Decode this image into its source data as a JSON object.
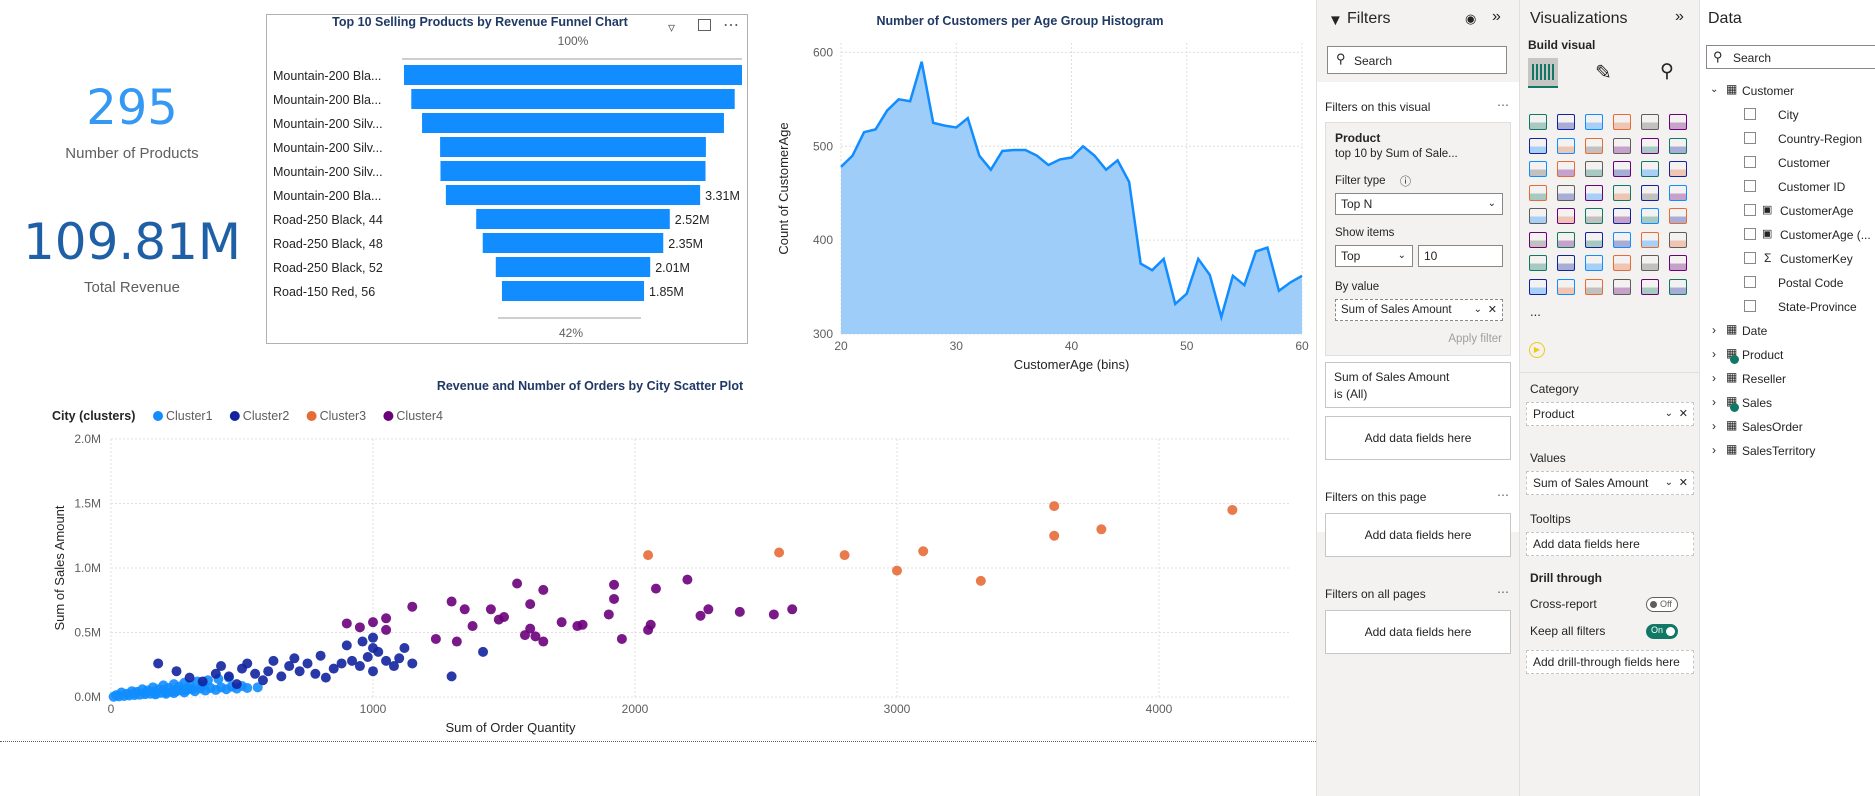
{
  "kpis": [
    {
      "value": "295",
      "label": "Number of Products"
    },
    {
      "value": "109.81M",
      "label": "Total Revenue"
    }
  ],
  "funnel": {
    "title": "Top 10 Selling Products by Revenue Funnel Chart",
    "top_pct": "100%",
    "bottom_pct": "42%",
    "data_labels": [
      "",
      "",
      "",
      "",
      "",
      "3.31M",
      "2.52M",
      "2.35M",
      "2.01M",
      "1.85M"
    ]
  },
  "histogram": {
    "title": "Number of Customers per Age Group Histogram",
    "xlabel": "CustomerAge (bins)",
    "ylabel": "Count of CustomerAge",
    "xticks": [
      "20",
      "30",
      "40",
      "50",
      "60"
    ],
    "yticks": [
      "300",
      "400",
      "500",
      "600"
    ]
  },
  "scatter": {
    "title": "Revenue and Number of Orders by City Scatter Plot",
    "legend_title": "City (clusters)",
    "xlabel": "Sum of Order Quantity",
    "ylabel": "Sum of Sales Amount",
    "xticks": [
      "0",
      "1000",
      "2000",
      "3000",
      "4000"
    ],
    "yticks": [
      "0.0M",
      "0.5M",
      "1.0M",
      "1.5M",
      "2.0M"
    ]
  },
  "chart_data": [
    {
      "type": "bar",
      "title": "Top 10 Selling Products by Revenue Funnel Chart",
      "categories": [
        "Mountain-200 Bla...",
        "Mountain-200 Bla...",
        "Mountain-200 Silv...",
        "Mountain-200 Silv...",
        "Mountain-200 Silv...",
        "Mountain-200 Bla...",
        "Road-250 Black, 44",
        "Road-250 Black, 48",
        "Road-250 Black, 52",
        "Road-150 Red, 56"
      ],
      "values": [
        4.4,
        4.21,
        3.93,
        3.46,
        3.45,
        3.31,
        2.52,
        2.35,
        2.01,
        1.85
      ],
      "unit": "M"
    },
    {
      "type": "area",
      "title": "Number of Customers per Age Group Histogram",
      "xlabel": "CustomerAge (bins)",
      "ylabel": "Count of CustomerAge",
      "xlim": [
        20,
        60
      ],
      "ylim": [
        300,
        610
      ],
      "x": [
        20,
        21,
        22,
        23,
        24,
        25,
        26,
        27,
        28,
        29,
        30,
        31,
        32,
        33,
        34,
        35,
        36,
        37,
        38,
        39,
        40,
        41,
        42,
        43,
        44,
        45,
        46,
        47,
        48,
        49,
        50,
        51,
        52,
        53,
        54,
        55,
        56,
        57,
        58,
        59,
        60
      ],
      "values": [
        478,
        490,
        515,
        518,
        538,
        550,
        548,
        590,
        525,
        522,
        520,
        530,
        490,
        475,
        495,
        496,
        496,
        490,
        480,
        486,
        488,
        500,
        490,
        475,
        485,
        462,
        375,
        368,
        380,
        332,
        343,
        380,
        363,
        318,
        362,
        352,
        388,
        392,
        346,
        355,
        362
      ]
    },
    {
      "type": "scatter",
      "title": "Revenue and Number of Orders by City Scatter Plot",
      "xlabel": "Sum of Order Quantity",
      "ylabel": "Sum of Sales Amount",
      "xlim": [
        0,
        4500
      ],
      "ylim": [
        0,
        2000000
      ],
      "legend_title": "City (clusters)",
      "series": [
        {
          "name": "Cluster1",
          "color": "#118dff",
          "points": [
            [
              10,
              2000
            ],
            [
              30,
              5000
            ],
            [
              50,
              8000
            ],
            [
              70,
              12000
            ],
            [
              90,
              15000
            ],
            [
              110,
              18000
            ],
            [
              130,
              22000
            ],
            [
              150,
              25000
            ],
            [
              170,
              28000
            ],
            [
              190,
              32000
            ],
            [
              210,
              35000
            ],
            [
              230,
              40000
            ],
            [
              250,
              45000
            ],
            [
              270,
              50000
            ],
            [
              290,
              55000
            ],
            [
              310,
              60000
            ],
            [
              340,
              65000
            ],
            [
              380,
              70000
            ],
            [
              420,
              75000
            ],
            [
              460,
              80000
            ],
            [
              500,
              85000
            ],
            [
              20,
              15000
            ],
            [
              60,
              25000
            ],
            [
              100,
              40000
            ],
            [
              140,
              50000
            ],
            [
              180,
              60000
            ],
            [
              220,
              70000
            ],
            [
              260,
              80000
            ],
            [
              300,
              90000
            ],
            [
              40,
              35000
            ],
            [
              80,
              45000
            ],
            [
              120,
              60000
            ],
            [
              160,
              75000
            ],
            [
              200,
              90000
            ],
            [
              240,
              100000
            ],
            [
              280,
              110000
            ],
            [
              330,
              120000
            ],
            [
              370,
              130000
            ],
            [
              410,
              140000
            ],
            [
              450,
              150000
            ],
            [
              160,
              40000
            ],
            [
              200,
              55000
            ],
            [
              240,
              30000
            ],
            [
              280,
              35000
            ],
            [
              320,
              45000
            ],
            [
              360,
              50000
            ],
            [
              400,
              55000
            ],
            [
              440,
              60000
            ],
            [
              480,
              65000
            ],
            [
              520,
              70000
            ],
            [
              560,
              75000
            ],
            [
              90,
              30000
            ],
            [
              130,
              35000
            ],
            [
              170,
              20000
            ],
            [
              210,
              25000
            ],
            [
              250,
              60000
            ],
            [
              290,
              65000
            ],
            [
              350,
              90000
            ]
          ]
        },
        {
          "name": "Cluster2",
          "color": "#12239e",
          "points": [
            [
              180,
              260000
            ],
            [
              250,
              200000
            ],
            [
              300,
              150000
            ],
            [
              350,
              120000
            ],
            [
              400,
              180000
            ],
            [
              420,
              240000
            ],
            [
              450,
              160000
            ],
            [
              480,
              100000
            ],
            [
              500,
              220000
            ],
            [
              520,
              260000
            ],
            [
              550,
              180000
            ],
            [
              580,
              130000
            ],
            [
              600,
              200000
            ],
            [
              620,
              280000
            ],
            [
              650,
              160000
            ],
            [
              680,
              240000
            ],
            [
              700,
              300000
            ],
            [
              720,
              200000
            ],
            [
              750,
              260000
            ],
            [
              780,
              180000
            ],
            [
              800,
              320000
            ],
            [
              820,
              150000
            ],
            [
              850,
              220000
            ],
            [
              880,
              260000
            ],
            [
              900,
              400000
            ],
            [
              920,
              280000
            ],
            [
              950,
              240000
            ],
            [
              980,
              310000
            ],
            [
              1000,
              200000
            ],
            [
              1020,
              350000
            ],
            [
              1050,
              280000
            ],
            [
              1080,
              240000
            ],
            [
              1100,
              300000
            ],
            [
              1120,
              380000
            ],
            [
              1150,
              260000
            ],
            [
              1000,
              380000
            ],
            [
              960,
              430000
            ],
            [
              1300,
              160000
            ],
            [
              1420,
              350000
            ],
            [
              1000,
              460000
            ]
          ]
        },
        {
          "name": "Cluster3",
          "color": "#e66c37",
          "points": [
            [
              2050,
              1100000
            ],
            [
              2550,
              1120000
            ],
            [
              2800,
              1100000
            ],
            [
              3000,
              980000
            ],
            [
              3100,
              1130000
            ],
            [
              3320,
              900000
            ],
            [
              3600,
              1250000
            ],
            [
              3600,
              1480000
            ],
            [
              3780,
              1300000
            ],
            [
              4280,
              1450000
            ]
          ]
        },
        {
          "name": "Cluster4",
          "color": "#6b007b",
          "points": [
            [
              900,
              570000
            ],
            [
              950,
              540000
            ],
            [
              1000,
              580000
            ],
            [
              1050,
              520000
            ],
            [
              1050,
              610000
            ],
            [
              1150,
              700000
            ],
            [
              1300,
              740000
            ],
            [
              1350,
              680000
            ],
            [
              1380,
              550000
            ],
            [
              1450,
              680000
            ],
            [
              1480,
              600000
            ],
            [
              1550,
              880000
            ],
            [
              1600,
              720000
            ],
            [
              1650,
              830000
            ],
            [
              1600,
              530000
            ],
            [
              1620,
              470000
            ],
            [
              1650,
              430000
            ],
            [
              1720,
              580000
            ],
            [
              1780,
              550000
            ],
            [
              1900,
              640000
            ],
            [
              1920,
              870000
            ],
            [
              1920,
              760000
            ],
            [
              1950,
              450000
            ],
            [
              2050,
              520000
            ],
            [
              2060,
              560000
            ],
            [
              2080,
              840000
            ],
            [
              2200,
              910000
            ],
            [
              2250,
              630000
            ],
            [
              2280,
              680000
            ],
            [
              2400,
              660000
            ],
            [
              2530,
              640000
            ],
            [
              2600,
              680000
            ],
            [
              1500,
              620000
            ],
            [
              1580,
              480000
            ],
            [
              1800,
              560000
            ],
            [
              1240,
              450000
            ],
            [
              1320,
              430000
            ]
          ]
        }
      ]
    }
  ],
  "filters": {
    "title": "Filters",
    "search": "Search",
    "on_visual": "Filters on this visual",
    "card_title": "Product",
    "card_sub": "top 10 by Sum of Sale...",
    "filter_type_lbl": "Filter type",
    "filter_type": "Top N",
    "show_items_lbl": "Show items",
    "show_dir": "Top",
    "show_n": "10",
    "by_value_lbl": "By value",
    "by_value": "Sum of Sales Amount",
    "apply": "Apply filter",
    "sum_card_l1": "Sum of Sales Amount",
    "sum_card_l2": "is (All)",
    "add": "Add data fields here",
    "on_page": "Filters on this page",
    "on_all": "Filters on all pages"
  },
  "viz": {
    "title": "Visualizations",
    "build": "Build visual",
    "category_lbl": "Category",
    "category": "Product",
    "values_lbl": "Values",
    "values": "Sum of Sales Amount",
    "tooltips_lbl": "Tooltips",
    "tooltips": "Add data fields here",
    "drill_lbl": "Drill through",
    "cross": "Cross-report",
    "cross_state": "Off",
    "keep": "Keep all filters",
    "keep_state": "On",
    "drill_add": "Add drill-through fields here",
    "more": "..."
  },
  "data": {
    "title": "Data",
    "search": "Search",
    "customer": {
      "name": "Customer",
      "fields": [
        "City",
        "Country-Region",
        "Customer",
        "Customer ID",
        "CustomerAge",
        "CustomerAge (...",
        "CustomerKey",
        "Postal Code",
        "State-Province"
      ]
    },
    "tables": [
      "Date",
      "Product",
      "Reseller",
      "Sales",
      "SalesOrder",
      "SalesTerritory"
    ]
  }
}
